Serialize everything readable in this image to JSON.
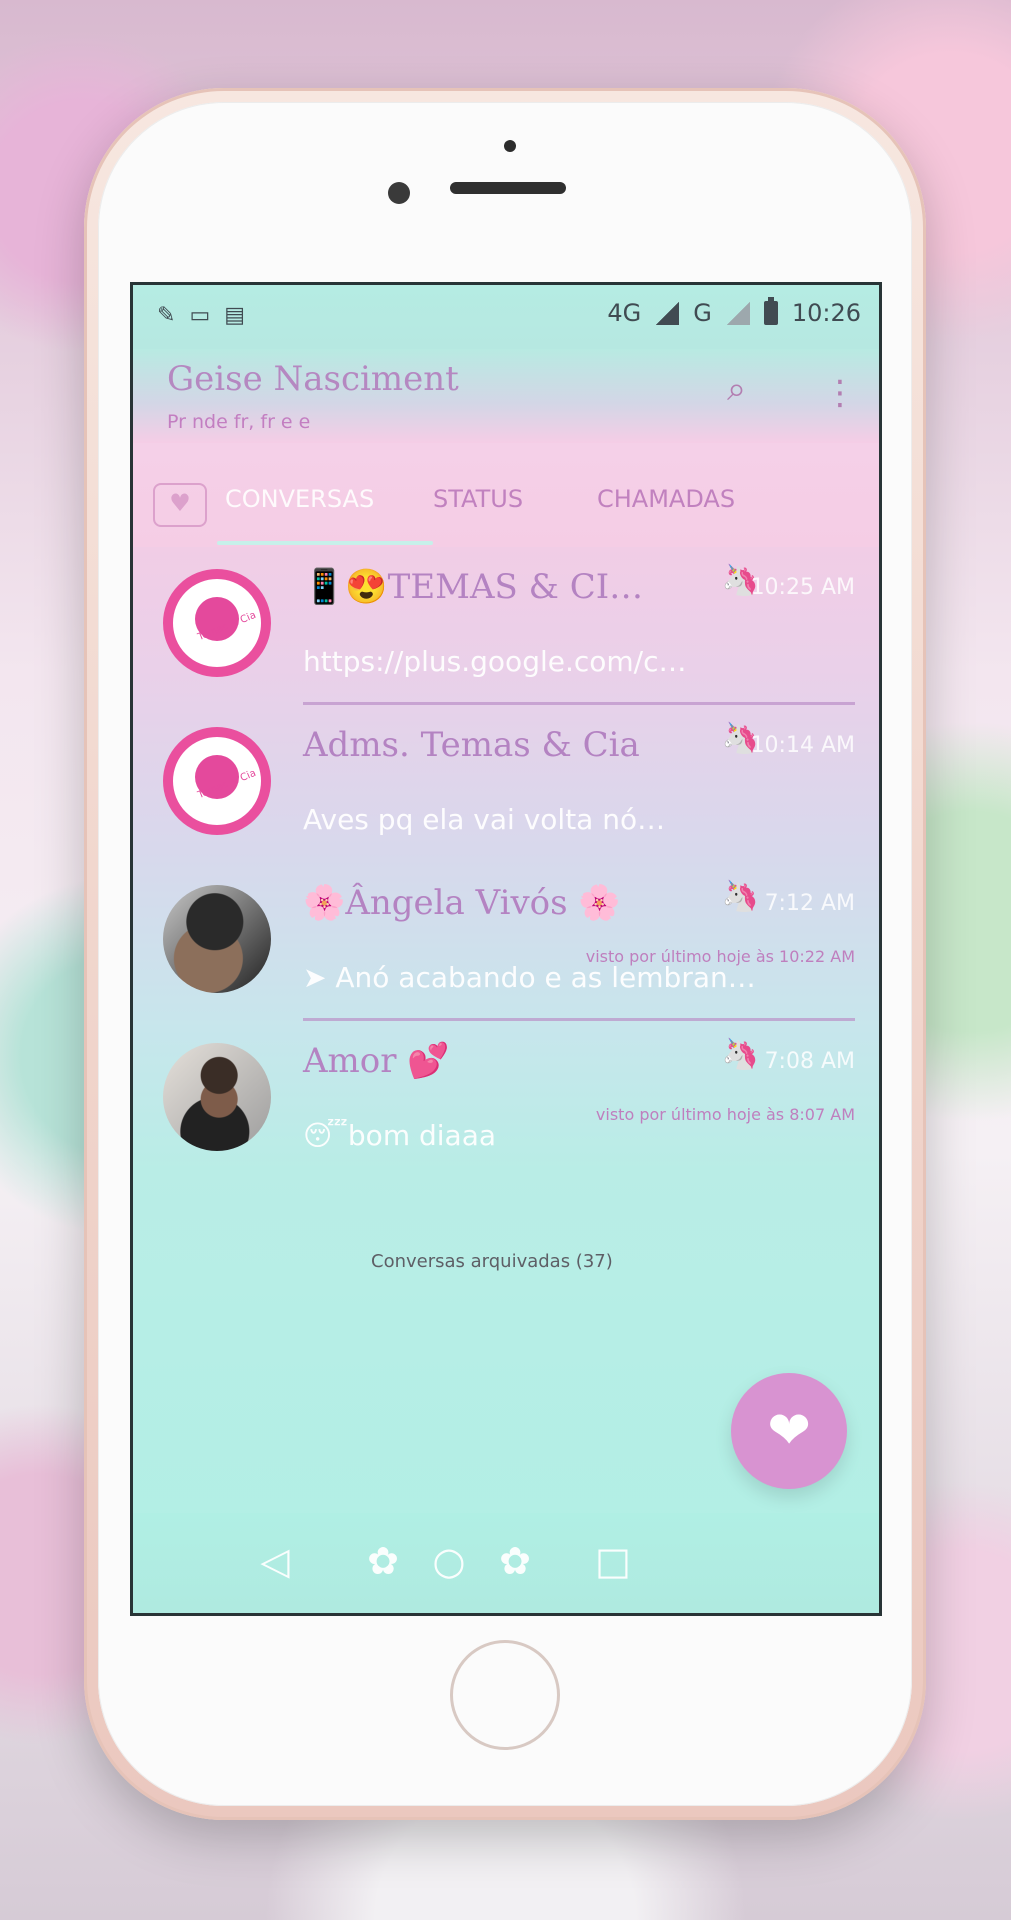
{
  "status_bar": {
    "left_icons": [
      "bandage-icon",
      "gallery-icon",
      "inbox-icon"
    ],
    "network_label": "4G",
    "secondary_network_label": "G",
    "time": "10:26"
  },
  "header": {
    "title": "Geise Nasciment",
    "subtitle": "Pr nde fr, fr e e"
  },
  "tabs": [
    {
      "label": "CONVERSAS"
    },
    {
      "label": "STATUS"
    },
    {
      "label": "CHAMADAS"
    }
  ],
  "chats": [
    {
      "name": "📱😍TEMAS & CI…",
      "time": "10:25 AM",
      "message": "https://plus.google.com/c…",
      "pony_icon": "pink-pony-icon"
    },
    {
      "name": "Adms. Temas & Cia",
      "time": "10:14 AM",
      "message": "Aves pq ela vai volta nó…",
      "pony_icon": "yellow-pony-icon"
    },
    {
      "name": "🌸Ângela Vivós 🌸",
      "time": "7:12 AM",
      "status": "visto por último hoje às 10:22 AM",
      "message": "➤ Anó acabando e as lembran…",
      "pony_icon": "blue-pony-icon"
    },
    {
      "name": "Amor 💕",
      "time": "7:08 AM",
      "status": "visto por último hoje às 8:07 AM",
      "message": "😴bom diaaa",
      "pony_icon": "yellow-pony-icon"
    }
  ],
  "archived_text": "Conversas arquivadas (37)",
  "fab_icon": "heart-plus-icon",
  "nav": [
    "back-icon",
    "home-icon",
    "recent-apps-icon"
  ]
}
